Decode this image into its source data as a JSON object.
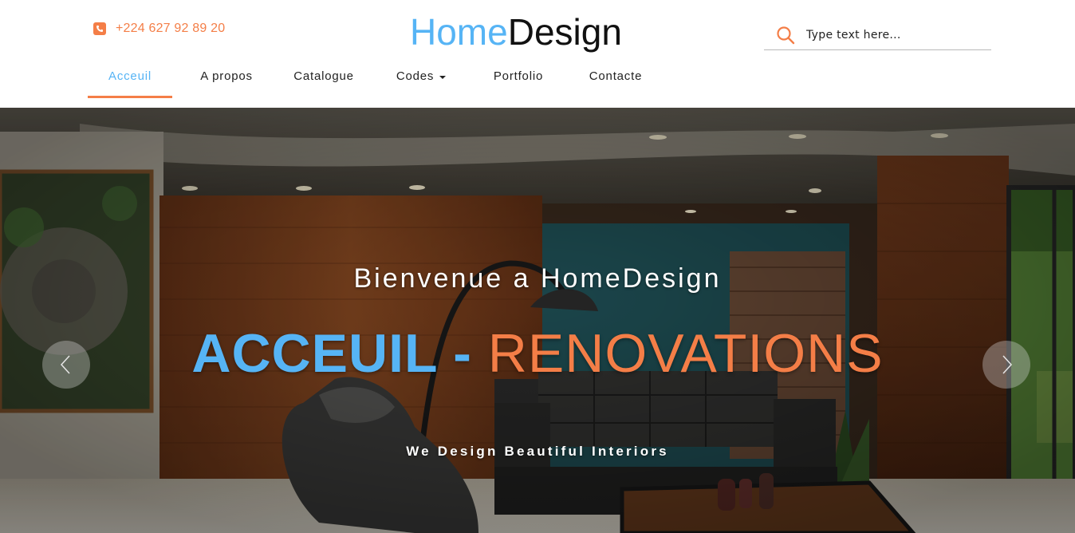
{
  "header": {
    "phone": "+224 627 92 89 20",
    "logo_part1": "Home",
    "logo_part2": "Design",
    "search_placeholder": "Type text here..."
  },
  "nav": {
    "items": [
      {
        "label": "Acceuil",
        "active": true
      },
      {
        "label": "A propos"
      },
      {
        "label": "Catalogue"
      },
      {
        "label": "Codes",
        "dropdown": true
      },
      {
        "label": "Portfolio"
      },
      {
        "label": "Contacte"
      }
    ]
  },
  "hero": {
    "subtitle": "Bienvenue a HomeDesign",
    "title_part1": "ACCEUIL",
    "title_separator": " - ",
    "title_part2": "RENOVATIONS",
    "tagline": "We Design Beautiful Interiors",
    "prev_icon": "chevron-left-icon",
    "next_icon": "chevron-right-icon"
  },
  "colors": {
    "accent_blue": "#56b4f5",
    "accent_orange": "#f47e47",
    "text_dark": "#222222"
  }
}
